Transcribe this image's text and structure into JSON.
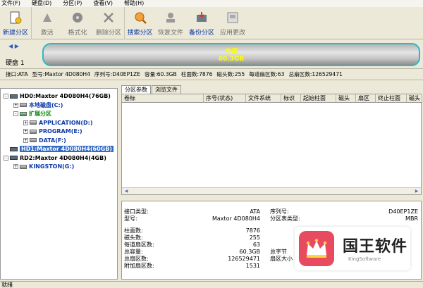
{
  "menu": [
    "文件(F)",
    "硬盘(D)",
    "分区(P)",
    "查看(V)",
    "帮助(H)"
  ],
  "toolbar": [
    {
      "label": "新建分区",
      "style": "blue",
      "icon": "new-partition-icon"
    },
    {
      "label": "激活",
      "style": "gray",
      "icon": "activate-icon"
    },
    {
      "label": "格式化",
      "style": "gray",
      "icon": "format-icon"
    },
    {
      "label": "删除分区",
      "style": "gray",
      "icon": "delete-icon"
    },
    {
      "label": "搜索分区",
      "style": "blue",
      "icon": "search-partition-icon"
    },
    {
      "label": "恢复文件",
      "style": "gray",
      "icon": "recover-file-icon"
    },
    {
      "label": "备份分区",
      "style": "blue",
      "icon": "backup-icon"
    },
    {
      "label": "应用更改",
      "style": "gray",
      "icon": "apply-icon"
    }
  ],
  "diskbar": {
    "label": "硬盘 1",
    "cyl_title": "空闲",
    "cyl_size": "60.3GB"
  },
  "infobar": [
    "接口:ATA",
    "型号:Maxtor 4D080H4",
    "序列号:D40EP1ZE",
    "容量:60.3GB",
    "柱面数:7876",
    "磁头数:255",
    "每道扇区数:63",
    "总扇区数:126529471"
  ],
  "tree": [
    {
      "label": "HD0:Maxtor 4D080H4(76GB)",
      "indent": 0,
      "type": "disk",
      "pm": "-",
      "color": "#000"
    },
    {
      "label": "本地磁盘(C:)",
      "indent": 1,
      "type": "part",
      "pm": "+",
      "color": "#0a36a8"
    },
    {
      "label": "扩展分区",
      "indent": 1,
      "type": "ext",
      "pm": "-",
      "color": "#0b8a0b"
    },
    {
      "label": "APPLICATION(D:)",
      "indent": 2,
      "type": "part",
      "pm": "+",
      "color": "#0a36a8"
    },
    {
      "label": "PROGRAM(E:)",
      "indent": 2,
      "type": "part",
      "pm": "+",
      "color": "#0a36a8"
    },
    {
      "label": "DATA(F:)",
      "indent": 2,
      "type": "part",
      "pm": "+",
      "color": "#0a36a8"
    },
    {
      "label": "HD1:Maxtor 4D080H4(60GB)",
      "indent": 0,
      "type": "disk",
      "pm": "",
      "color": "#fff",
      "selected": true
    },
    {
      "label": "RD2:Maxtor 4D080H4(4GB)",
      "indent": 0,
      "type": "disk",
      "pm": "-",
      "color": "#000"
    },
    {
      "label": "KINGSTON(G:)",
      "indent": 1,
      "type": "part",
      "pm": "+",
      "color": "#0a36a8"
    }
  ],
  "tabs": [
    "分区参数",
    "浏览文件"
  ],
  "columns": [
    "卷标",
    "序号(状态)",
    "文件系统",
    "标识",
    "起始柱面",
    "磁头",
    "扇区",
    "终止柱面",
    "磁头"
  ],
  "details": [
    {
      "k": "接口类型:",
      "v": "ATA"
    },
    {
      "k": "型号:",
      "v": "Maxtor 4D080H4"
    },
    {
      "k": "柱面数:",
      "v": "7876"
    },
    {
      "k": "磁头数:",
      "v": "255"
    },
    {
      "k": "每道扇区数:",
      "v": "63"
    },
    {
      "k": "总容量:",
      "v": "60.3GB"
    },
    {
      "k": "总扇区数:",
      "v": "126529471"
    },
    {
      "k": "附加扇区数:",
      "v": "1531"
    }
  ],
  "details_right": [
    {
      "k": "序列号:",
      "v": "D40EP1ZE"
    },
    {
      "k": "分区表类型:",
      "v": "MBR"
    },
    {
      "k": "总字节",
      "v": ""
    },
    {
      "k": "扇区大小",
      "v": ""
    }
  ],
  "status": "就绪",
  "logo": {
    "name": "国王软件",
    "sub": "KingSoftware"
  }
}
